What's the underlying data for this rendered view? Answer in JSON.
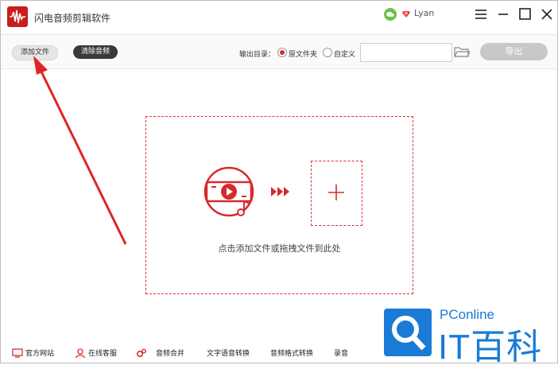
{
  "app": {
    "title": "闪电音频剪辑软件"
  },
  "user": {
    "name": "Lyan"
  },
  "toolbar": {
    "add_file_label": "添加文件",
    "clear_audio_label": "清除音频",
    "output_dir_label": "输出目录：",
    "radio_source_label": "原文件夹",
    "radio_custom_label": "自定义",
    "selected_option": "原文件夹",
    "path_value": "",
    "export_label": "导出"
  },
  "drop_zone": {
    "hint": "点击添加文件或拖拽文件到此处"
  },
  "bottom_nav": [
    {
      "label": "官方网站",
      "icon": "monitor-icon"
    },
    {
      "label": "在线客服",
      "icon": "person-icon"
    },
    {
      "label": "音频合并",
      "icon": "gear-icon"
    },
    {
      "label": "文字语音转换",
      "icon": ""
    },
    {
      "label": "音频格式转换",
      "icon": ""
    },
    {
      "label": "录音",
      "icon": ""
    }
  ],
  "watermark": {
    "small": "PConline",
    "big": "IT百科"
  },
  "colors": {
    "accent": "#d62b2b",
    "watermark": "#1a7bd6"
  }
}
